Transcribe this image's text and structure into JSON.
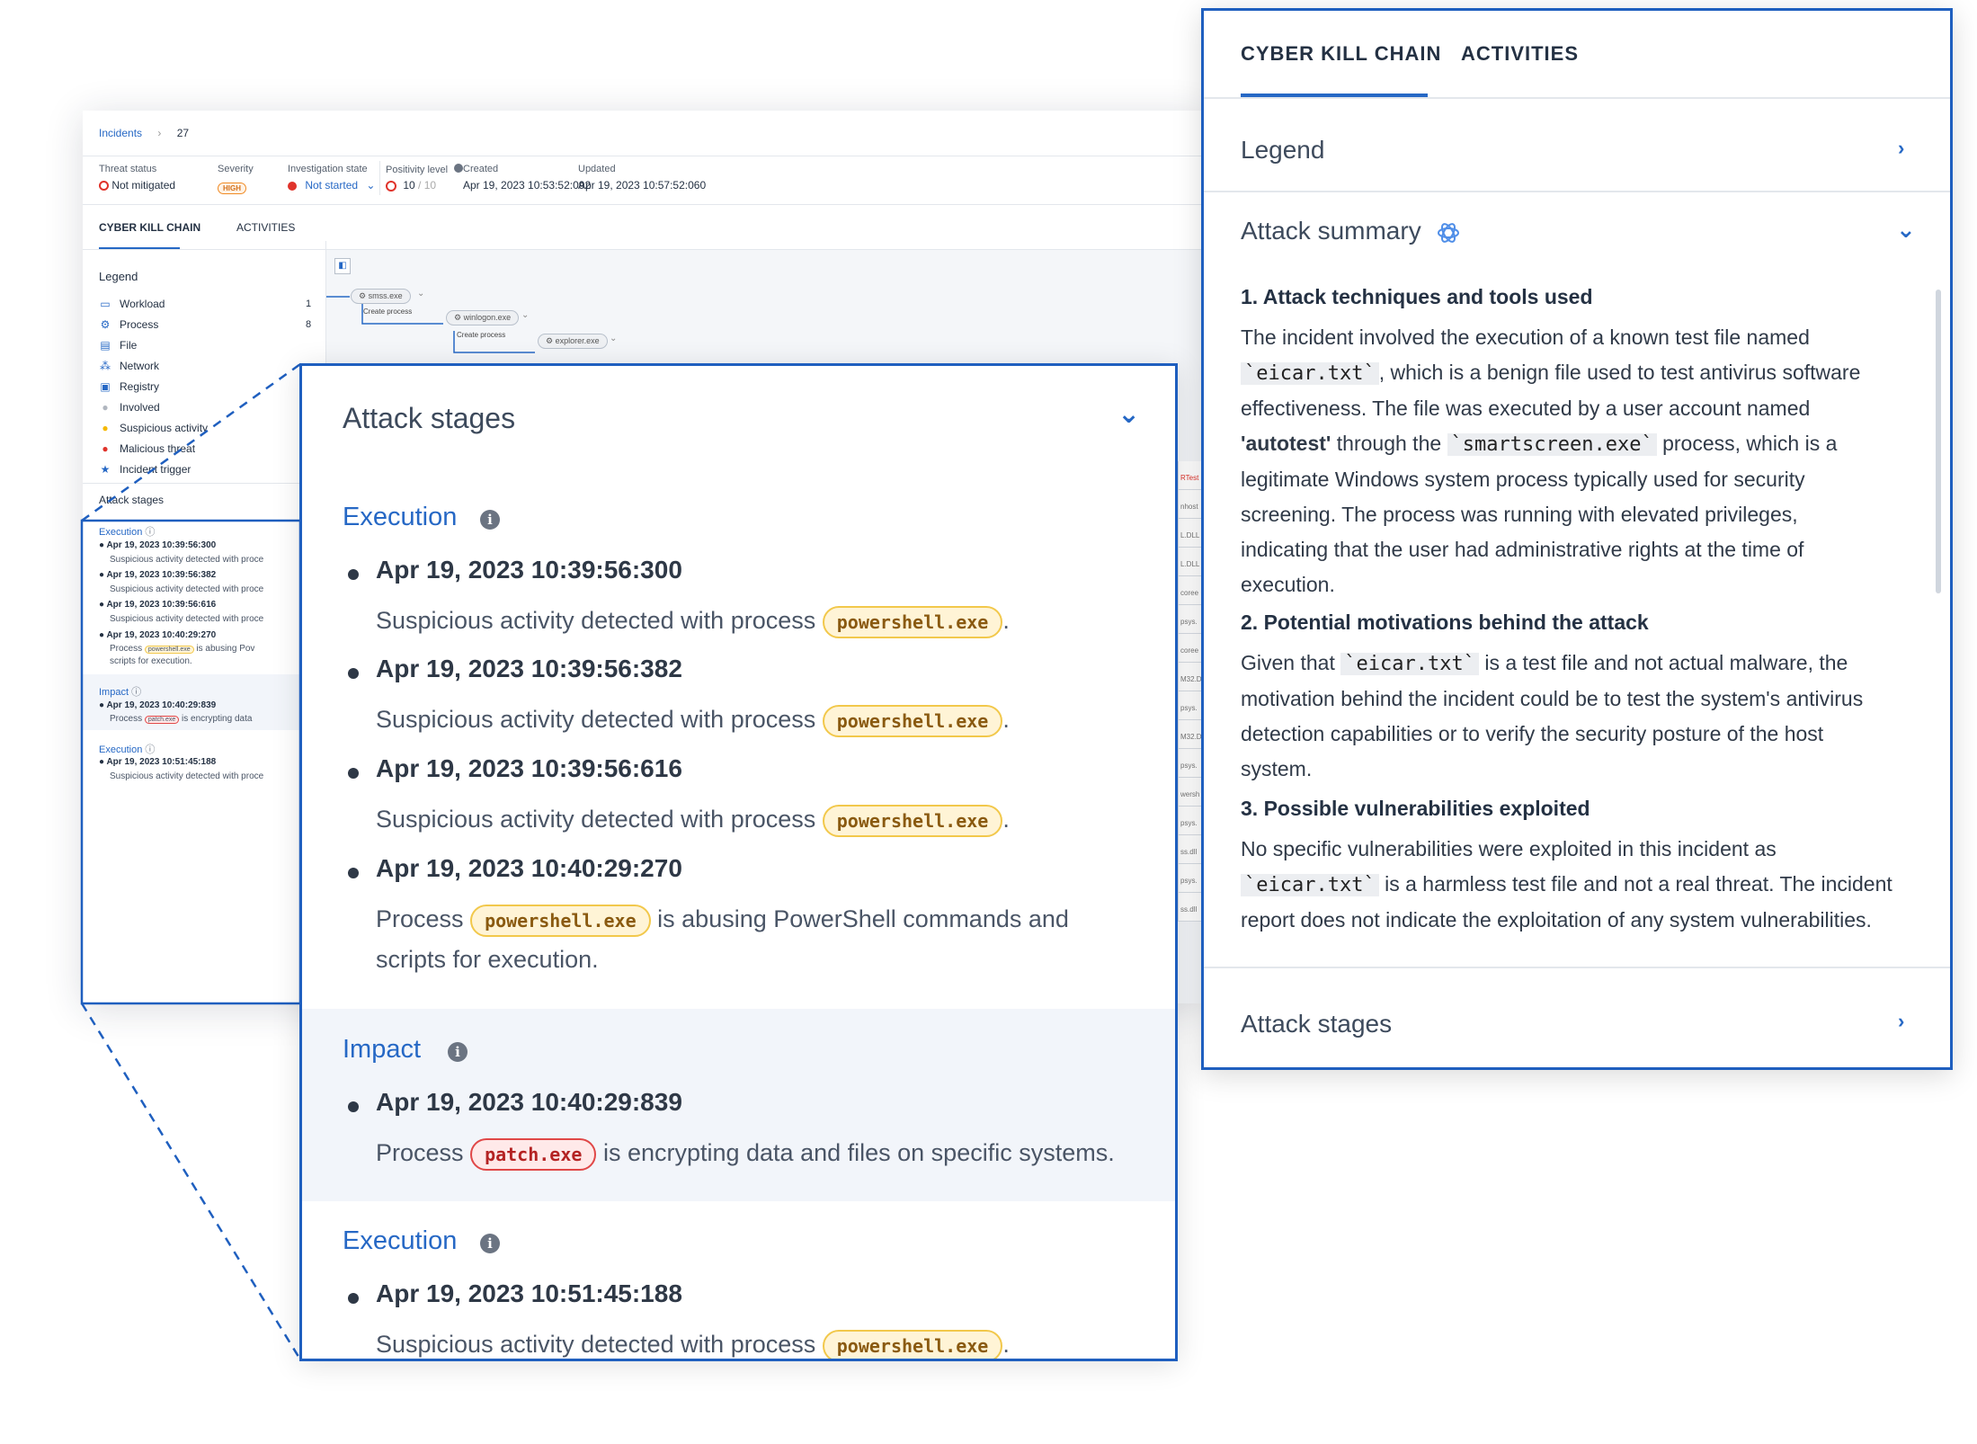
{
  "incident": {
    "breadcrumb_root": "Incidents",
    "breadcrumb_sep": "›",
    "incident_id": "27",
    "fields": {
      "threat_status_label": "Threat status",
      "threat_status_value": "Not mitigated",
      "severity_label": "Severity",
      "severity_value": "HIGH",
      "investigation_label": "Investigation state",
      "investigation_value": "Not started",
      "positivity_label": "Positivity level",
      "positivity_value": "10",
      "positivity_max": "/ 10",
      "created_label": "Created",
      "created_value": "Apr 19, 2023 10:53:52:092",
      "updated_label": "Updated",
      "updated_value": "Apr 19, 2023 10:57:52:060"
    },
    "tabs": [
      "CYBER KILL CHAIN",
      "ACTIVITIES"
    ],
    "legend": {
      "title": "Legend",
      "items": [
        {
          "label": "Workload",
          "count": "1",
          "icon": "monitor-icon"
        },
        {
          "label": "Process",
          "count": "8",
          "icon": "gear-icon"
        },
        {
          "label": "File",
          "count": "",
          "icon": "file-icon"
        },
        {
          "label": "Network",
          "count": "",
          "icon": "network-icon"
        },
        {
          "label": "Registry",
          "count": "",
          "icon": "registry-icon"
        },
        {
          "label": "Involved",
          "count": "",
          "icon": "grey-dot-icon"
        },
        {
          "label": "Suspicious activity",
          "count": "",
          "icon": "yellow-dot-icon"
        },
        {
          "label": "Malicious threat",
          "count": "",
          "icon": "red-dot-icon"
        },
        {
          "label": "Incident trigger",
          "count": "",
          "icon": "star-icon"
        }
      ]
    },
    "graph": {
      "nodes": [
        "smss.exe",
        "winlogon.exe",
        "explorer.exe"
      ],
      "edge_label": "Create process"
    },
    "attack_stages_small": {
      "title": "Attack stages",
      "groups": [
        {
          "stage": "Execution",
          "entries": [
            {
              "ts": "Apr 19, 2023 10:39:56:300",
              "desc": "Suspicious activity detected with proce"
            },
            {
              "ts": "Apr 19, 2023 10:39:56:382",
              "desc": "Suspicious activity detected with proce"
            },
            {
              "ts": "Apr 19, 2023 10:39:56:616",
              "desc": "Suspicious activity detected with proce"
            },
            {
              "ts": "Apr 19, 2023 10:40:29:270",
              "desc_pre": "Process",
              "pill": "powershell.exe",
              "desc_post": "is abusing Pov",
              "desc2": "scripts for execution."
            }
          ]
        },
        {
          "stage": "Impact",
          "entries": [
            {
              "ts": "Apr 19, 2023 10:40:29:839",
              "desc_pre": "Process",
              "pill": "patch.exe",
              "desc_post": "is encrypting data"
            }
          ]
        },
        {
          "stage": "Execution",
          "entries": [
            {
              "ts": "Apr 19, 2023 10:51:45:188",
              "desc": "Suspicious activity detected with proce"
            }
          ]
        }
      ]
    },
    "side_strip": [
      "RTest",
      "nhost",
      "L.DLL",
      "L.DLL",
      "coree",
      "psys.",
      "coree",
      "M32.D",
      "psys.",
      "M32.D",
      "psys.",
      "wersh",
      "psys.",
      "ss.dll",
      "psys.",
      "ss.dll"
    ]
  },
  "zoom": {
    "title": "Attack stages",
    "groups": [
      {
        "stage": "Execution",
        "entries": [
          {
            "ts": "Apr 19, 2023 10:39:56:300",
            "pre": "Suspicious activity detected with process",
            "pill": "powershell.exe",
            "post": "."
          },
          {
            "ts": "Apr 19, 2023 10:39:56:382",
            "pre": "Suspicious activity detected with process",
            "pill": "powershell.exe",
            "post": "."
          },
          {
            "ts": "Apr 19, 2023 10:39:56:616",
            "pre": "Suspicious activity detected with process",
            "pill": "powershell.exe",
            "post": "."
          },
          {
            "ts": "Apr 19, 2023 10:40:29:270",
            "pre": "Process",
            "pill": "powershell.exe",
            "post": "is abusing PowerShell commands and",
            "line2": "scripts for execution."
          }
        ]
      },
      {
        "stage": "Impact",
        "entries": [
          {
            "ts": "Apr 19, 2023 10:40:29:839",
            "pre": "Process",
            "pill": "patch.exe",
            "post": "is encrypting data and files on specific systems."
          }
        ]
      },
      {
        "stage": "Execution",
        "entries": [
          {
            "ts": "Apr 19, 2023 10:51:45:188",
            "pre": "Suspicious activity detected with process",
            "pill": "powershell.exe",
            "post": "."
          }
        ]
      }
    ]
  },
  "ai": {
    "tabs": [
      "CYBER KILL CHAIN",
      "ACTIVITIES"
    ],
    "legend": "Legend",
    "summary_title": "Attack summary",
    "attack_stages": "Attack stages",
    "s1_heading": "1. Attack techniques and tools used",
    "s1_a": "The incident involved the execution of a known test file named",
    "s1_code1": "`eicar.txt`",
    "s1_b": ", which is a benign file used to test antivirus software",
    "s1_c": "effectiveness. The file was executed by a user account named",
    "s1_bold": "'autotest'",
    "s1_d": " through the ",
    "s1_code2": "`smartscreen.exe`",
    "s1_e": " process, which is a",
    "s1_f": "legitimate Windows system process typically used for security",
    "s1_g": "screening. The process was running with elevated privileges,",
    "s1_h": "indicating that the user had administrative rights at the time of",
    "s1_i": "execution.",
    "s2_heading": "2. Potential motivations behind the attack",
    "s2_a": "Given that ",
    "s2_code": "`eicar.txt`",
    "s2_b": " is a test file and not actual malware, the",
    "s2_c": "motivation behind the incident could be to test the system's antivirus",
    "s2_d": "detection capabilities or to verify the security posture of the host",
    "s2_e": "system.",
    "s3_heading": "3. Possible vulnerabilities exploited",
    "s3_a": "No specific vulnerabilities were exploited in this incident as",
    "s3_code": "`eicar.txt`",
    "s3_b": " is a harmless test file and not a real threat. The incident",
    "s3_c": "report does not indicate the exploitation of any system vulnerabilities."
  },
  "colors": {
    "accent": "#2668c5",
    "frame": "#1f5fbf",
    "suspicious_pill": "#f2c84b",
    "malicious_pill": "#e04747"
  }
}
